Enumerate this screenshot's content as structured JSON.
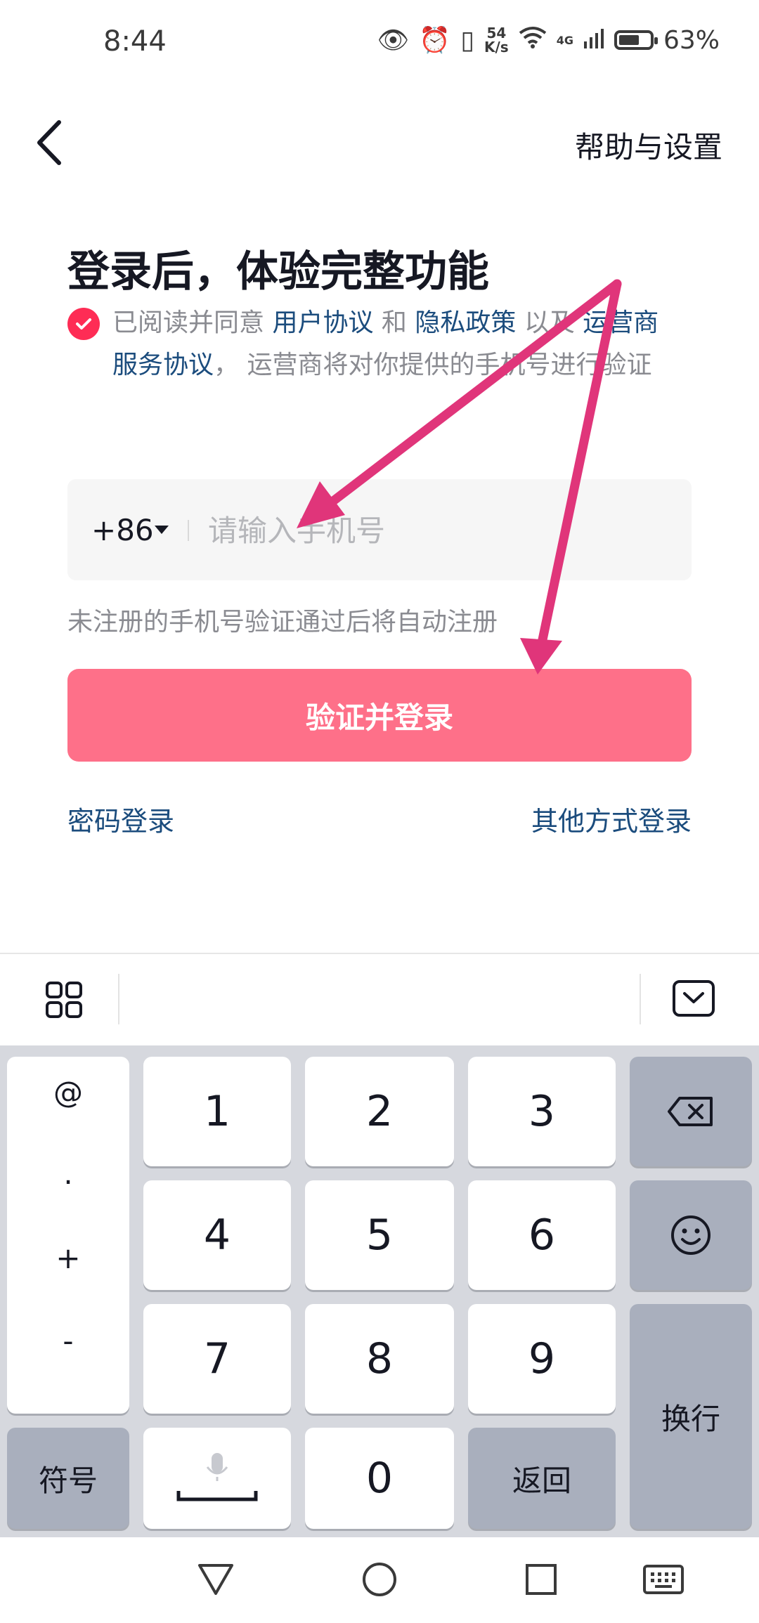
{
  "status_bar": {
    "time": "8:44",
    "net_speed_value": "54",
    "net_speed_unit": "K/s",
    "signal_label": "4G",
    "battery": "63%"
  },
  "header": {
    "help_label": "帮助与设置"
  },
  "main": {
    "title": "登录后，体验完整功能",
    "agreement": {
      "prefix": "已阅读并同意 ",
      "user_agreement": "用户协议",
      "and": " 和 ",
      "privacy_policy": "隐私政策",
      "as_well_as": " 以及 ",
      "carrier_agreement": "运营商服务协议",
      "suffix": "， 运营商将对你提供的手机号进行验证"
    },
    "country_code": "+86",
    "phone_placeholder": "请输入手机号",
    "hint": "未注册的手机号验证通过后将自动注册",
    "login_button": "验证并登录",
    "password_login": "密码登录",
    "other_login": "其他方式登录"
  },
  "keyboard": {
    "symbols": [
      "@",
      ".",
      "+",
      "-"
    ],
    "keys": [
      "1",
      "2",
      "3",
      "4",
      "5",
      "6",
      "7",
      "8",
      "9",
      "0"
    ],
    "symbol_key": "符号",
    "return_key": "返回",
    "enter_key": "换行"
  },
  "colors": {
    "brand_red": "#fe2c55",
    "button_pink": "#fe7089",
    "link_blue": "#1b4c7d",
    "annotation_arrow": "#e0357a"
  }
}
